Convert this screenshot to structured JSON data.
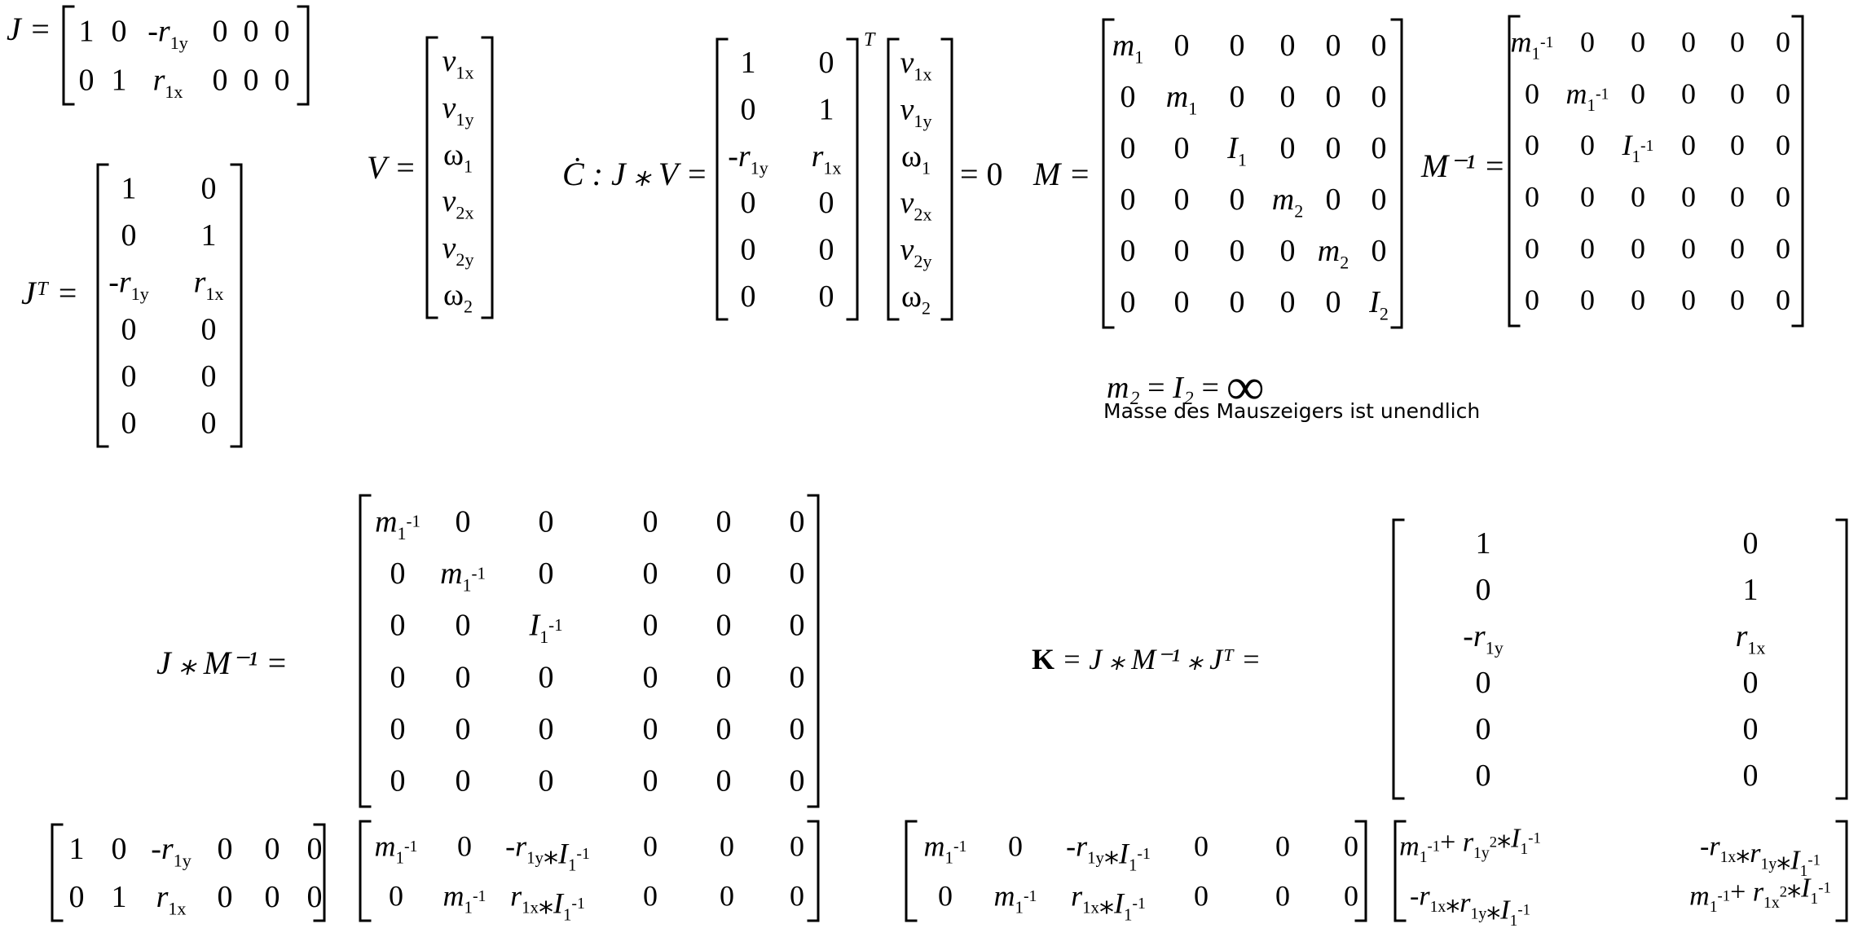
{
  "note": "Masse des Mauszeigers ist unendlich",
  "infinity": "∞",
  "eq_mass": {
    "lhs": "m₂",
    "mid": "I₂",
    "rhs": "="
  },
  "labels": {
    "J": "J =",
    "JT": "Jᵀ =",
    "V": "V =",
    "C_prefix": "Ċ : J ⁎ V =",
    "C_suffix": "= 0",
    "C_T": "T",
    "M": "M =",
    "Minv": "M⁻¹ =",
    "JMinv": "J ⁎ M⁻¹ =",
    "K_bold": "K",
    "K_rest": "= J ⁎ M⁻¹ ⁎ Jᵀ ="
  },
  "matrices": {
    "J": [
      [
        "1",
        "0",
        "-r1y",
        "0",
        "0",
        "0"
      ],
      [
        "0",
        "1",
        "r1x",
        "0",
        "0",
        "0"
      ]
    ],
    "JT": [
      [
        "1",
        "0"
      ],
      [
        "0",
        "1"
      ],
      [
        "-r1y",
        "r1x"
      ],
      [
        "0",
        "0"
      ],
      [
        "0",
        "0"
      ],
      [
        "0",
        "0"
      ]
    ],
    "V": [
      [
        "v1x"
      ],
      [
        "v1y"
      ],
      [
        "ω1"
      ],
      [
        "v2x"
      ],
      [
        "v2y"
      ],
      [
        "ω2"
      ]
    ],
    "C": [
      [
        "1",
        "0"
      ],
      [
        "0",
        "1"
      ],
      [
        "-r1y",
        "r1x"
      ],
      [
        "0",
        "0"
      ],
      [
        "0",
        "0"
      ],
      [
        "0",
        "0"
      ]
    ],
    "CV": [
      [
        "v1x"
      ],
      [
        "v1y"
      ],
      [
        "ω1"
      ],
      [
        "v2x"
      ],
      [
        "v2y"
      ],
      [
        "ω2"
      ]
    ],
    "M": [
      [
        "m1",
        "0",
        "0",
        "0",
        "0",
        "0"
      ],
      [
        "0",
        "m1",
        "0",
        "0",
        "0",
        "0"
      ],
      [
        "0",
        "0",
        "I1",
        "0",
        "0",
        "0"
      ],
      [
        "0",
        "0",
        "0",
        "m2",
        "0",
        "0"
      ],
      [
        "0",
        "0",
        "0",
        "0",
        "m2",
        "0"
      ],
      [
        "0",
        "0",
        "0",
        "0",
        "0",
        "I2"
      ]
    ],
    "Minv": [
      [
        "m1^-1",
        "0",
        "0",
        "0",
        "0",
        "0"
      ],
      [
        "0",
        "m1^-1",
        "0",
        "0",
        "0",
        "0"
      ],
      [
        "0",
        "0",
        "I1^-1",
        "0",
        "0",
        "0"
      ],
      [
        "0",
        "0",
        "0",
        "0",
        "0",
        "0"
      ],
      [
        "0",
        "0",
        "0",
        "0",
        "0",
        "0"
      ],
      [
        "0",
        "0",
        "0",
        "0",
        "0",
        "0"
      ]
    ],
    "Minv2": [
      [
        "m1^-1",
        "0",
        "0",
        "0",
        "0",
        "0"
      ],
      [
        "0",
        "m1^-1",
        "0",
        "0",
        "0",
        "0"
      ],
      [
        "0",
        "0",
        "I1^-1",
        "0",
        "0",
        "0"
      ],
      [
        "0",
        "0",
        "0",
        "0",
        "0",
        "0"
      ],
      [
        "0",
        "0",
        "0",
        "0",
        "0",
        "0"
      ],
      [
        "0",
        "0",
        "0",
        "0",
        "0",
        "0"
      ]
    ],
    "JT2": [
      [
        "1",
        "0"
      ],
      [
        "0",
        "1"
      ],
      [
        "-r1y",
        "r1x"
      ],
      [
        "0",
        "0"
      ],
      [
        "0",
        "0"
      ],
      [
        "0",
        "0"
      ]
    ],
    "J3": [
      [
        "1",
        "0",
        "-r1y",
        "0",
        "0",
        "0"
      ],
      [
        "0",
        "1",
        "r1x",
        "0",
        "0",
        "0"
      ]
    ],
    "JMres": [
      [
        "m1^-1",
        "0",
        "-r1y*I1^-1",
        "0",
        "0",
        "0"
      ],
      [
        "0",
        "m1^-1",
        "r1x*I1^-1",
        "0",
        "0",
        "0"
      ]
    ],
    "JMres2": [
      [
        "m1^-1",
        "0",
        "-r1y*I1^-1",
        "0",
        "0",
        "0"
      ],
      [
        "0",
        "m1^-1",
        "r1x*I1^-1",
        "0",
        "0",
        "0"
      ]
    ],
    "Kres": [
      [
        "m1^-1+ r1y^2*I1^-1",
        "-r1x*r1y*I1^-1"
      ],
      [
        "-r1x*r1y*I1^-1",
        "m1^-1+ r1x^2*I1^-1"
      ]
    ]
  }
}
